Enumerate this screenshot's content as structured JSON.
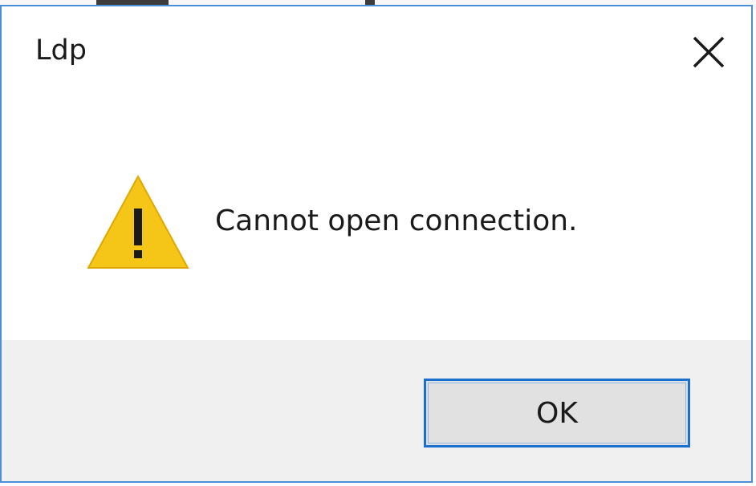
{
  "dialog": {
    "title": "Ldp",
    "message": "Cannot open connection.",
    "icon": "warning-icon",
    "ok_label": "OK",
    "close_icon": "close-icon"
  },
  "colors": {
    "accent_border": "#4a90d9",
    "button_focus": "#1a6fcf",
    "footer_bg": "#f0f0f0",
    "warning_yellow": "#f5c518"
  }
}
